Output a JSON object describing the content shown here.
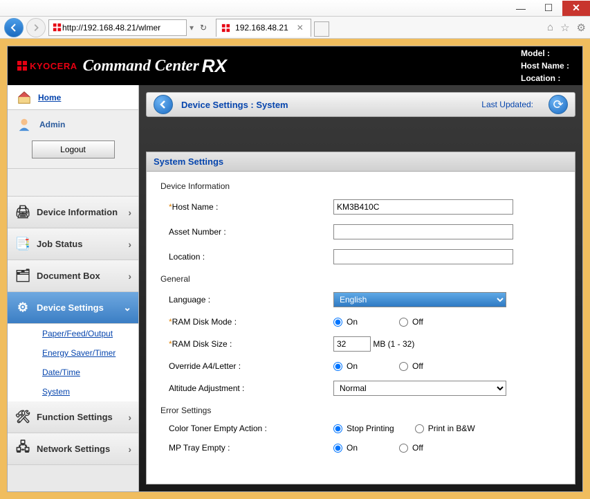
{
  "window": {
    "minimize": "—",
    "maximize": "☐",
    "close": "✕"
  },
  "browser": {
    "url_gray1": "http://",
    "url_host": "192.168.48.21",
    "url_gray2": "/wlmer",
    "tab_title": "192.168.48.21",
    "home_icon": "⌂",
    "star_icon": "☆",
    "gear_icon": "⚙"
  },
  "header": {
    "brand": "KYOCERA",
    "title": "Command Center",
    "title_rx": "RX",
    "model_lbl": "Model :",
    "hostname_lbl": "Host Name :",
    "location_lbl": "Location :"
  },
  "sidebar": {
    "home": "Home",
    "user": "Admin",
    "logout": "Logout",
    "items": [
      {
        "label": "Device Information"
      },
      {
        "label": "Job Status"
      },
      {
        "label": "Document Box"
      },
      {
        "label": "Device Settings"
      },
      {
        "label": "Function Settings"
      },
      {
        "label": "Network Settings"
      }
    ],
    "sub": [
      "Paper/Feed/Output",
      "Energy Saver/Timer",
      "Date/Time",
      "System"
    ]
  },
  "crumb": {
    "text": "Device Settings : System",
    "updated": "Last Updated:"
  },
  "panel": {
    "title": "System Settings",
    "devinfo": "Device Information",
    "hostname_lbl": "Host Name :",
    "hostname_val": "KM3B410C",
    "asset_lbl": "Asset Number :",
    "asset_val": "",
    "location_lbl": "Location :",
    "location_val": "",
    "general": "General",
    "language_lbl": "Language :",
    "language_val": "English",
    "ramdiskmode_lbl": "RAM Disk Mode :",
    "ramsize_lbl": "RAM Disk Size :",
    "ramsize_val": "32",
    "ramsize_unit": " MB (1 - 32)",
    "override_lbl": "Override A4/Letter :",
    "altitude_lbl": "Altitude Adjustment :",
    "altitude_val": "Normal",
    "errset": "Error Settings",
    "ctoner_lbl": "Color Toner Empty Action :",
    "ctoner_stop": "Stop Printing",
    "ctoner_bw": "Print in B&W",
    "mptray_lbl": "MP Tray Empty :",
    "on": "On",
    "off": "Off"
  }
}
